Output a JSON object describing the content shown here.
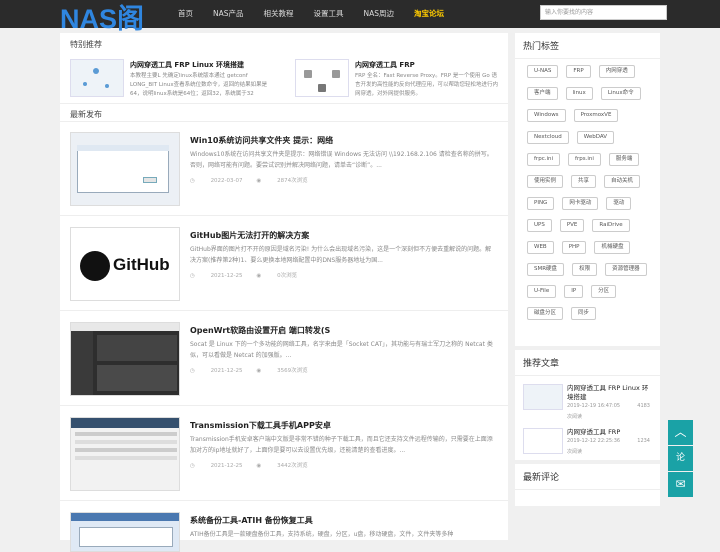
{
  "header": {
    "logo": "NAS阁",
    "nav": [
      "首页",
      "NAS产品",
      "相关教程",
      "设置工具",
      "NAS周边",
      "淘宝论坛"
    ],
    "search_placeholder": "输入你要找的内容"
  },
  "featured": {
    "title": "特别推荐",
    "items": [
      {
        "title": "内网穿透工具 FRP Linux 环境搭建",
        "desc": "本教程主要L 先确定linux系统版本通过 getconf LONG_BIT Linux查看系统位数命令，返回的结果如果是64，说明linux系统是64位；返回32，系统属于32"
      },
      {
        "title": "内网穿透工具 FRP",
        "desc": "FRP 全名：Fast Reverse Proxy。FRP 是一个使用 Go 语言开发的高性能的反向代理应用，可以帮助您轻松地进行内网穿透，对外网提供服务。"
      }
    ]
  },
  "latest": {
    "title": "最新发布",
    "posts": [
      {
        "title": "Win10系统访问共享文件夹 提示：网络",
        "desc": "Windows10系统在访问共享文件夹是提示：网络错误 Windows 无法访问 \\\\192.168.2.106 请检查名称的拼写。否则，网络可能有问题。要尝试识别并解决网络问题，请单击“诊断”。...",
        "date": "2022-03-07",
        "views": "2874次浏览"
      },
      {
        "title": "GitHub图片无法打开的解决方案",
        "desc": "GitHub界面的图片打不开的原因是域名污染! 为什么会出现域名污染，这是一个深刻但不方便去重解说的问题。解决方案(推荐第2种)1、要么更换本地网络配置中的DNS服务器地址为国...",
        "date": "2021-12-25",
        "views": "0次浏览",
        "logo": "GitHub"
      },
      {
        "title": "OpenWrt软路由设置开启 端口转发(S",
        "desc": "Socat 是 Linux 下的一个多功能的网络工具，名字来由是「Socket CAT」，其功能与有瑞士军刀之称的 Netcat 类似，可以看做是 Netcat 的加强版。...",
        "date": "2021-12-25",
        "views": "3569次浏览"
      },
      {
        "title": "Transmission下载工具手机APP安卓",
        "desc": "Transmission手机安卓客户端中文版是非常不错的种子下载工具，而且它还支持文件远程传输的，只需要在上面添加对方的ip地址就好了，上面你是要可以去设置优先级，还能清楚的查看进度。...",
        "date": "2021-12-25",
        "views": "3442次浏览"
      },
      {
        "title": "系统备份工具-ATIH 备份恢复工具",
        "desc": "ATIH备份工具是一款硬盘备份工具，支持系统，硬盘，分区，u盘，移动硬盘，文件，文件夹等多种"
      }
    ]
  },
  "hot_tags": {
    "title": "热门标签",
    "tags": [
      "U-NAS",
      "FRP",
      "内网穿透",
      "客户端",
      "linux",
      "Linux命令",
      "Windows",
      "ProxmoxVE",
      "Nextcloud",
      "WebDAV",
      "frpc.ini",
      "frps.ini",
      "服务端",
      "使用实例",
      "共享",
      "自动关机",
      "PING",
      "网卡驱动",
      "驱动",
      "UPS",
      "PVE",
      "RaiDrive",
      "WEB",
      "PHP",
      "机械硬盘",
      "SMR硬盘",
      "权限",
      "资源管理器",
      "U-File",
      "IP",
      "分区",
      "磁盘分区",
      "同步"
    ]
  },
  "recommended": {
    "title": "推荐文章",
    "items": [
      {
        "title": "内网穿透工具 FRP Linux 环境搭建",
        "date": "2019-12-19 16:47:05",
        "count": "4183",
        "unit": "次阅读"
      },
      {
        "title": "内网穿透工具 FRP",
        "date": "2019-12-12 22:25:36",
        "count": "1234",
        "unit": "次阅读"
      }
    ]
  },
  "comments": {
    "title": "最新评论"
  },
  "float": {
    "top_icon": "chevron-up-icon",
    "comment": "论",
    "mail_icon": "mail-icon"
  },
  "colors": {
    "header_bg": "#2b2b2b",
    "logo": "#2f86e0",
    "accent": "#ffcc00",
    "float_bg": "#1aa2a6"
  }
}
